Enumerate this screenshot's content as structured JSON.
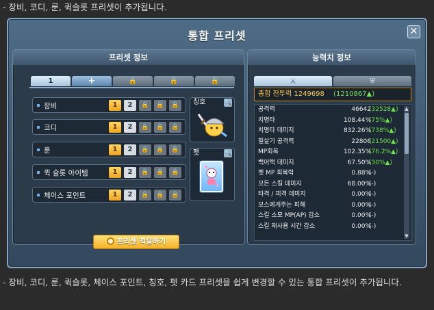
{
  "captions": {
    "top": "- 장비, 코디, 룬, 퀵슬롯 프리셋이 추가됩니다.",
    "bottom": "- 장비, 코디, 룬, 퀵슬롯, 체이스 포인트, 칭호, 펫 카드 프리셋을 쉽게 변경할 수 있는 통합 프리셋이 추가됩니다."
  },
  "window": {
    "title": "통합 프리셋",
    "close_glyph": "✕"
  },
  "left_panel": {
    "header": "프리셋 정보",
    "tabs": [
      {
        "label": "1",
        "state": "active"
      },
      {
        "label": "+",
        "state": "add"
      },
      {
        "label": "🔒",
        "state": "locked"
      },
      {
        "label": "🔒",
        "state": "locked"
      },
      {
        "label": "🔒",
        "state": "locked"
      }
    ],
    "slots": [
      {
        "label": "장비",
        "buttons": [
          "1",
          "2",
          "🔒",
          "🔒",
          "🔒"
        ]
      },
      {
        "label": "코디",
        "buttons": [
          "1",
          "2",
          "🔒",
          "🔒",
          "🔒"
        ]
      },
      {
        "label": "룬",
        "buttons": [
          "1",
          "2",
          "🔒",
          "🔒",
          "🔒"
        ]
      },
      {
        "label": "퀵 슬롯 아이템",
        "buttons": [
          "1",
          "2",
          "🔒",
          "🔒",
          "🔒"
        ]
      },
      {
        "label": "체이스 포인트",
        "buttons": [
          "1",
          "2",
          "🔒",
          "🔒",
          "🔒"
        ]
      }
    ],
    "title_box": {
      "label": "칭호",
      "search_icon": "🔍"
    },
    "pet_box": {
      "label": "펫",
      "search_icon": "🔍"
    },
    "apply_button": "프리셋 적용하기"
  },
  "right_panel": {
    "header": "능력치 정보",
    "tabs": [
      {
        "icon": "crossed-swords-icon",
        "glyph": "⚔",
        "state": "active"
      },
      {
        "icon": "shield-icon",
        "glyph": "⛨",
        "state": "off"
      }
    ],
    "combat_power": {
      "label": "종합 전투력",
      "value": "1249698",
      "diff": "(1210867▲)"
    },
    "stats": [
      {
        "name": "공격력",
        "value": "46642",
        "diff": "(32528▲)",
        "up": true
      },
      {
        "name": "치명타",
        "value": "108.44%",
        "diff": "(75%▲)",
        "up": true
      },
      {
        "name": "치명타 데미지",
        "value": "832.26%",
        "diff": "(738%▲)",
        "up": true
      },
      {
        "name": "필살기 공격력",
        "value": "22806",
        "diff": "(21500▲)",
        "up": true
      },
      {
        "name": "MP회복",
        "value": "102.35%",
        "diff": "(76.2%▲)",
        "up": true
      },
      {
        "name": "백어택 데미지",
        "value": "67.50%",
        "diff": "(30%▲)",
        "up": true
      },
      {
        "name": "펫 MP 회복력",
        "value": "0.88%",
        "diff": "(-)",
        "up": false
      },
      {
        "name": "모든 스킬 데미지",
        "value": "68.00%",
        "diff": "(-)",
        "up": false
      },
      {
        "name": "타격 / 피격 데미지",
        "value": "0.00%",
        "diff": "(-)",
        "up": false
      },
      {
        "name": "보스에게주는 피해",
        "value": "0.00%",
        "diff": "(-)",
        "up": false
      },
      {
        "name": "스킬 소모 MP(AP) 감소",
        "value": "0.00%",
        "diff": "(-)",
        "up": false
      },
      {
        "name": "스킬 재사용 시간 감소",
        "value": "0.00%",
        "diff": "(-)",
        "up": false
      }
    ]
  }
}
